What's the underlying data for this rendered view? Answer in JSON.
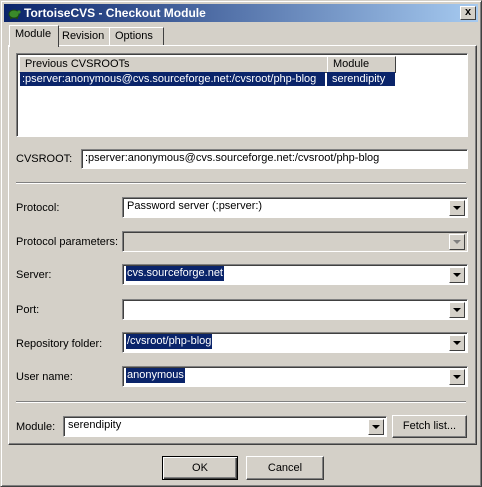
{
  "window": {
    "title": "TortoiseCVS - Checkout Module",
    "close_label": "x"
  },
  "tabs": [
    {
      "label": "Module",
      "active": true
    },
    {
      "label": "Revision",
      "active": false
    },
    {
      "label": "Options",
      "active": false
    }
  ],
  "history": {
    "columns": [
      "Previous CVSROOTs",
      "Module"
    ],
    "rows": [
      {
        "cvsroot": ":pserver:anonymous@cvs.sourceforge.net:/cvsroot/php-blog",
        "module": "serendipity",
        "selected": true
      }
    ]
  },
  "cvsroot": {
    "label": "CVSROOT:",
    "value": ":pserver:anonymous@cvs.sourceforge.net:/cvsroot/php-blog"
  },
  "fields": {
    "protocol": {
      "label": "Protocol:",
      "value": "Password server (:pserver:)"
    },
    "protocol_parameters": {
      "label": "Protocol parameters:",
      "value": ""
    },
    "server": {
      "label": "Server:",
      "value": "cvs.sourceforge.net"
    },
    "port": {
      "label": "Port:",
      "value": ""
    },
    "repository_folder": {
      "label": "Repository folder:",
      "value": "/cvsroot/php-blog"
    },
    "user_name": {
      "label": "User name:",
      "value": "anonymous"
    }
  },
  "module": {
    "label": "Module:",
    "value": "serendipity",
    "fetch_button": "Fetch list..."
  },
  "buttons": {
    "ok": "OK",
    "cancel": "Cancel"
  }
}
